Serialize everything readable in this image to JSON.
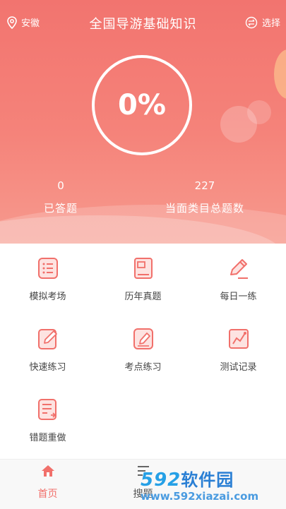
{
  "header": {
    "location": "安徽",
    "title": "全国导游基础知识",
    "select_label": "选择"
  },
  "progress": {
    "percent_text": "0%"
  },
  "stats": {
    "answered_count": "0",
    "answered_label": "已答题",
    "total_count": "227",
    "total_label": "当面类目总题数"
  },
  "menu": [
    {
      "label": "模拟考场",
      "icon": "list-doc-icon"
    },
    {
      "label": "历年真题",
      "icon": "book-icon"
    },
    {
      "label": "每日一练",
      "icon": "pencil-icon"
    },
    {
      "label": "快速练习",
      "icon": "edit-doc-icon"
    },
    {
      "label": "考点练习",
      "icon": "notebook-pen-icon"
    },
    {
      "label": "测试记录",
      "icon": "chart-icon"
    },
    {
      "label": "错题重做",
      "icon": "redo-doc-icon"
    }
  ],
  "tabbar": {
    "home_label": "首页",
    "search_label": "搜题"
  },
  "watermark": {
    "number": "592",
    "name": "软件园",
    "url": "www.592xiazai.com"
  },
  "colors": {
    "accent": "#f1706b",
    "hero_top": "#f2746f",
    "hero_bottom": "#f79a8e"
  }
}
